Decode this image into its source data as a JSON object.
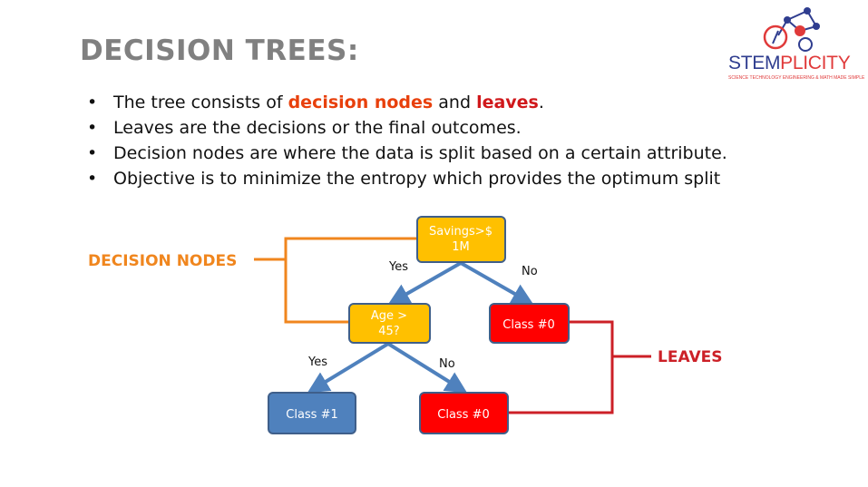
{
  "title": "DECISION TREES:",
  "logo": {
    "name_part1": "STEM",
    "name_part2": "PLICITY",
    "tagline": "SCIENCE TECHNOLOGY ENGINEERING & MATH MADE SIMPLE"
  },
  "bullets": [
    {
      "before": "The tree consists of ",
      "em1": "decision nodes",
      "middle": " and ",
      "em2": "leaves",
      "after": "."
    },
    {
      "text": "Leaves are the decisions or the final outcomes."
    },
    {
      "text": "Decision nodes are where the data is split based on a certain attribute."
    },
    {
      "text": "Objective is to minimize the entropy which provides the optimum split"
    }
  ],
  "diagram": {
    "root": {
      "line1": "Savings>$",
      "line2": "1M"
    },
    "age_node": {
      "line1": "Age >",
      "line2": "45?"
    },
    "right_leaf": "Class #0",
    "leaf_left": "Class #1",
    "leaf_mid": "Class #0",
    "edge_yes_1": "Yes",
    "edge_no_1": "No",
    "edge_yes_2": "Yes",
    "edge_no_2": "No",
    "decision_label": "DECISION NODES",
    "leaves_label": "LEAVES"
  },
  "colors": {
    "decision_node": "#ffc000",
    "leaf_red": "#ff0000",
    "leaf_blue": "#4f81bd",
    "arrow": "#4f81bd",
    "orange": "#f0861e",
    "red": "#cc2027"
  }
}
